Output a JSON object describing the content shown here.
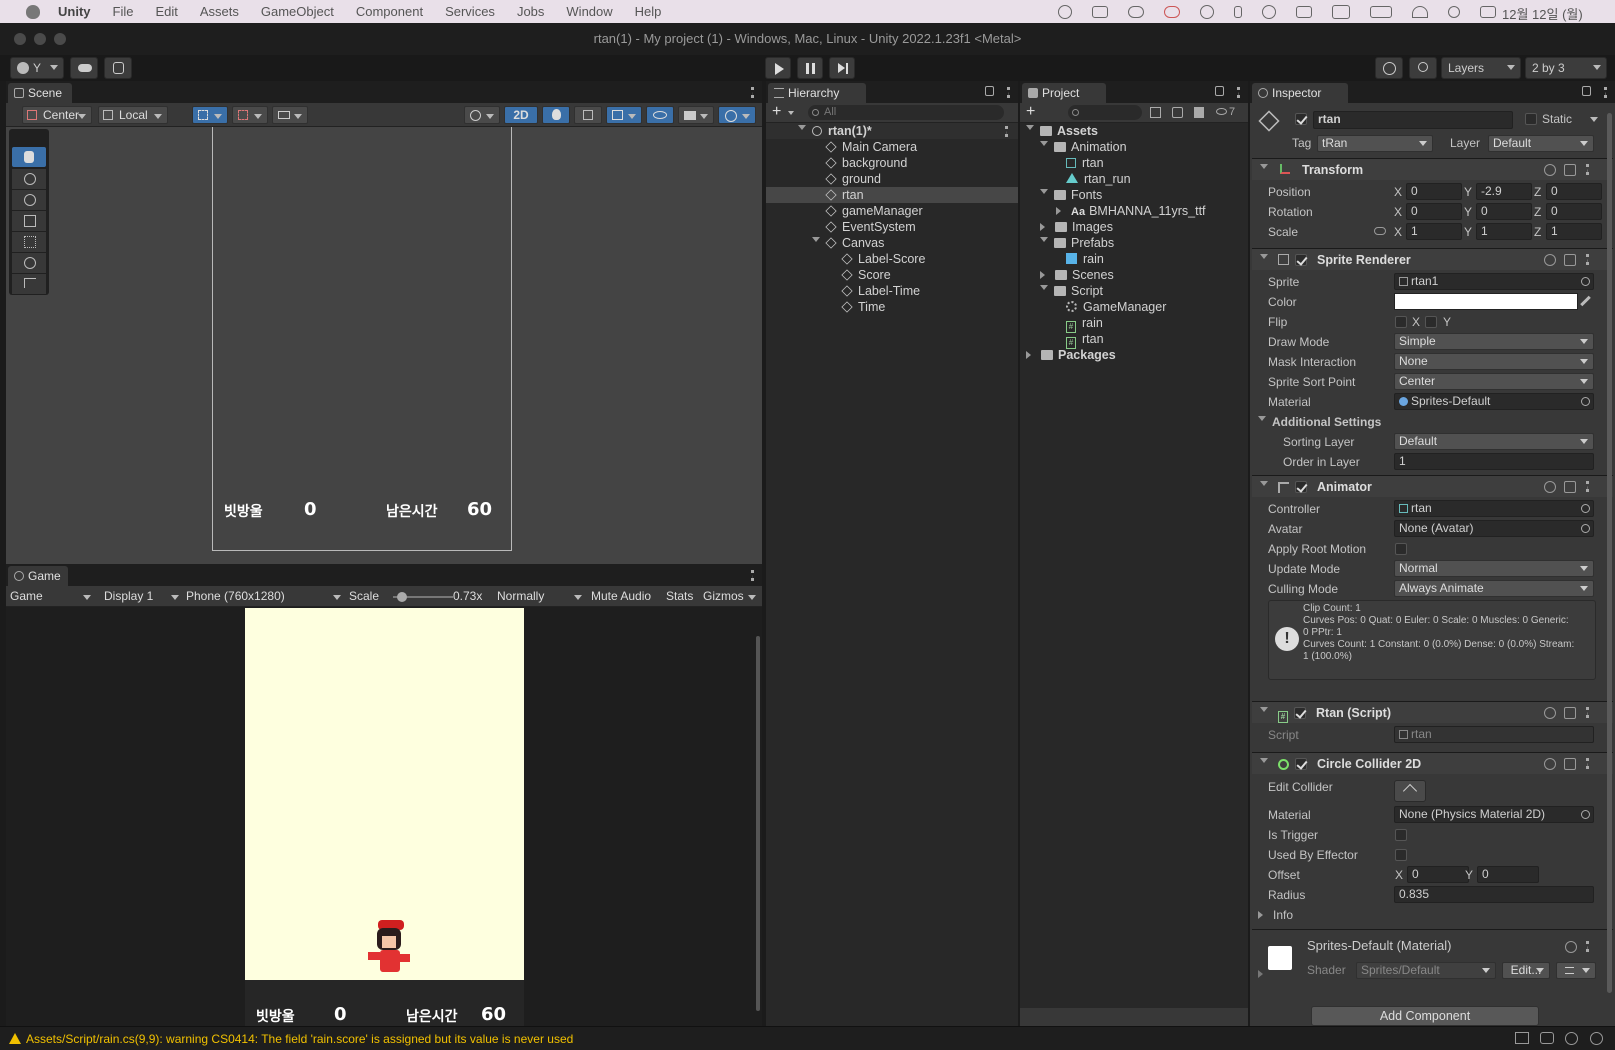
{
  "menubar": {
    "app": "Unity",
    "items": [
      "File",
      "Edit",
      "Assets",
      "GameObject",
      "Component",
      "Services",
      "Jobs",
      "Window",
      "Help"
    ],
    "date": "12월 12일 (월)"
  },
  "window_title": "rtan(1) - My project (1) - Windows, Mac, Linux - Unity 2022.1.23f1 <Metal>",
  "toolbar": {
    "account": "Y",
    "layers": "Layers",
    "layout": "2 by 3"
  },
  "scene": {
    "tab": "Scene",
    "center": "Center",
    "local": "Local",
    "mode2d": "2D",
    "label_score": "빗방울",
    "score": "0",
    "label_time": "남은시간",
    "time": "60"
  },
  "game": {
    "tab": "Game",
    "view": "Game",
    "display": "Display 1",
    "resolution": "Phone (760x1280)",
    "scale_label": "Scale",
    "scale_value": 0.73,
    "scale_text": "0.73x",
    "normally": "Normally",
    "mute": "Mute Audio",
    "stats": "Stats",
    "gizmos": "Gizmos",
    "label_score": "빗방울",
    "score": "0",
    "label_time": "남은시간",
    "time": "60"
  },
  "hierarchy": {
    "tab": "Hierarchy",
    "search": "All",
    "root": "rtan(1)*",
    "items": [
      "Main Camera",
      "background",
      "ground",
      "rtan",
      "gameManager",
      "EventSystem",
      "Canvas"
    ],
    "canvas_children": [
      "Label-Score",
      "Score",
      "Label-Time",
      "Time"
    ]
  },
  "project": {
    "tab": "Project",
    "hidden_count": "7",
    "root": "Assets",
    "animation": "Animation",
    "anim_items": [
      "rtan",
      "rtan_run"
    ],
    "fonts": "Fonts",
    "font_item": "BMHANNA_11yrs_ttf",
    "images": "Images",
    "prefabs": "Prefabs",
    "prefab_item": "rain",
    "scenes": "Scenes",
    "script": "Script",
    "script_items": [
      "GameManager",
      "rain",
      "rtan"
    ],
    "packages": "Packages"
  },
  "inspector": {
    "tab": "Inspector",
    "name": "rtan",
    "static": "Static",
    "tag_label": "Tag",
    "tag": "tRan",
    "layer_label": "Layer",
    "layer": "Default",
    "transform": {
      "title": "Transform",
      "position": "Position",
      "rotation": "Rotation",
      "scale": "Scale",
      "pos": [
        "0",
        "-2.9",
        "0"
      ],
      "rot": [
        "0",
        "0",
        "0"
      ],
      "scl": [
        "1",
        "1",
        "1"
      ]
    },
    "sprite_renderer": {
      "title": "Sprite Renderer",
      "sprite_label": "Sprite",
      "sprite": "rtan1",
      "color_label": "Color",
      "flip_label": "Flip",
      "draw_label": "Draw Mode",
      "draw": "Simple",
      "mask_label": "Mask Interaction",
      "mask": "None",
      "sort_label": "Sprite Sort Point",
      "sort": "Center",
      "material_label": "Material",
      "material": "Sprites-Default",
      "additional": "Additional Settings",
      "sorting_layer_label": "Sorting Layer",
      "sorting_layer": "Default",
      "order_label": "Order in Layer",
      "order": "1"
    },
    "animator": {
      "title": "Animator",
      "controller_label": "Controller",
      "controller": "rtan",
      "avatar_label": "Avatar",
      "avatar": "None (Avatar)",
      "root_motion": "Apply Root Motion",
      "update_label": "Update Mode",
      "update": "Normal",
      "culling_label": "Culling Mode",
      "culling": "Always Animate",
      "info_lines": [
        "Clip Count: 1",
        "Curves Pos: 0 Quat: 0 Euler: 0 Scale: 0 Muscles: 0 Generic:",
        "0 PPtr: 1",
        "Curves Count: 1 Constant: 0 (0.0%) Dense: 0 (0.0%) Stream:",
        "1 (100.0%)"
      ]
    },
    "script_comp": {
      "title": "Rtan (Script)",
      "script_label": "Script",
      "script": "rtan"
    },
    "collider": {
      "title": "Circle Collider 2D",
      "edit_label": "Edit Collider",
      "material_label": "Material",
      "material": "None (Physics Material 2D)",
      "trigger_label": "Is Trigger",
      "effector_label": "Used By Effector",
      "offset_label": "Offset",
      "offset": [
        "0",
        "0"
      ],
      "radius_label": "Radius",
      "radius": "0.835",
      "info": "Info"
    },
    "material": {
      "name": "Sprites-Default (Material)",
      "shader_label": "Shader",
      "shader": "Sprites/Default",
      "edit": "Edit..."
    },
    "add_component": "Add Component"
  },
  "status": "Assets/Script/rain.cs(9,9): warning CS0414: The field 'rain.score' is assigned but its value is never used",
  "axis_labels": {
    "x": "X",
    "y": "Y",
    "z": "Z"
  }
}
